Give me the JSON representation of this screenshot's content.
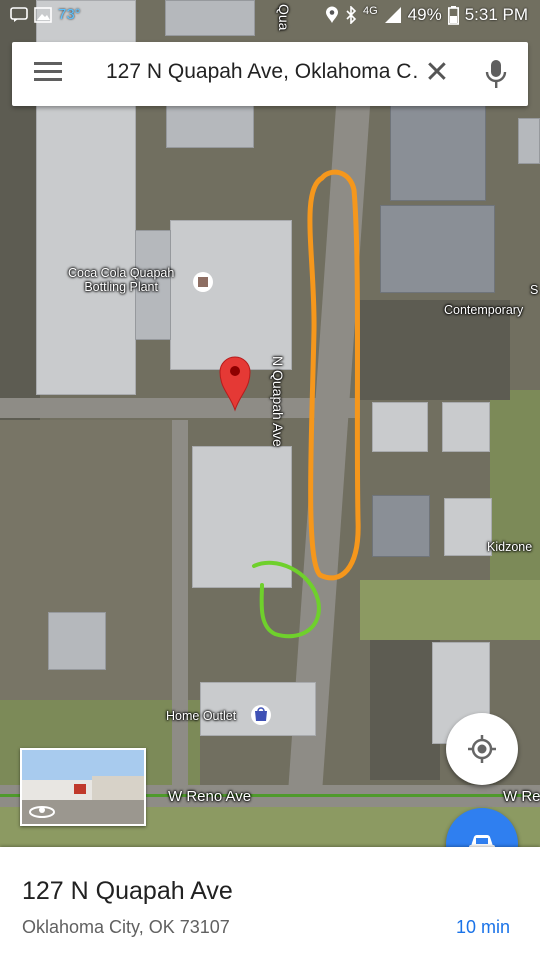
{
  "status_bar": {
    "left_icons": [
      "message-icon",
      "image-icon"
    ],
    "temperature": "73°",
    "network": "4G",
    "battery": "49%",
    "time": "5:31 PM"
  },
  "search": {
    "value": "127 N Quapah Ave, Oklahoma C…"
  },
  "map": {
    "labels": {
      "plant": "Coca Cola Quapah\nBottling Plant",
      "contemporary": "Contemporary",
      "kidzone": "Kidzone",
      "home_outlet": "Home Outlet",
      "street_quapah": "N Quapah Ave",
      "street_reno": "W Reno Ave",
      "street_reno_right": "W Re",
      "top_street": "Qua",
      "edge_s": "S"
    },
    "annotation_colors": {
      "orange": "#f5971c",
      "green": "#6fd02c"
    },
    "pin_color": "#e53935"
  },
  "place": {
    "title": "127 N Quapah Ave",
    "subtitle": "Oklahoma City, OK 73107",
    "drive_time": "10 min"
  },
  "colors": {
    "accent_blue": "#2f7ff0",
    "link_blue": "#1a73e8"
  }
}
